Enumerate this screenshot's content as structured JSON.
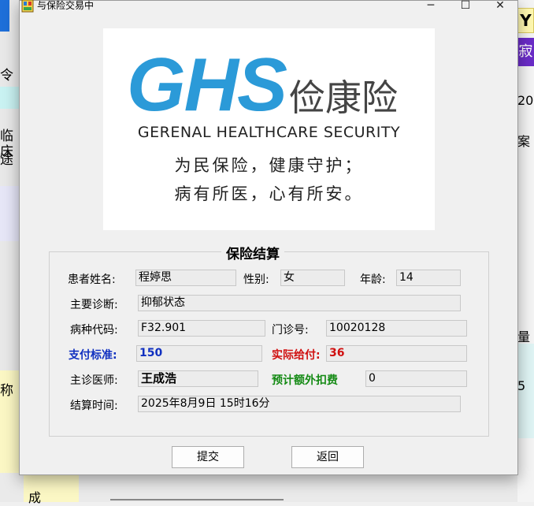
{
  "window": {
    "title": "与保险交易中",
    "min_icon": "minimize-icon",
    "max_icon": "maximize-icon",
    "close_icon": "close-icon"
  },
  "logo": {
    "brand": "GHS",
    "name_cn": "俭康险",
    "name_en": "GERENAL HEALTHCARE SECURITY",
    "slogan_line1": "为民保险，健康守护；",
    "slogan_line2": "病有所医，心有所安。",
    "brand_color": "#2b9ad8"
  },
  "settlement": {
    "group_title": "保险结算",
    "patient_name_label": "患者姓名:",
    "patient_name": "程婷思",
    "gender_label": "性别:",
    "gender": "女",
    "age_label": "年龄:",
    "age": "14",
    "diagnosis_label": "主要诊断:",
    "diagnosis": "抑郁状态",
    "disease_code_label": "病种代码:",
    "disease_code": "F32.901",
    "clinic_no_label": "门诊号:",
    "clinic_no": "10020128",
    "pay_standard_label": "支付标准:",
    "pay_standard": "150",
    "actual_pay_label": "实际给付:",
    "actual_pay": "36",
    "doctor_label": "主诊医师:",
    "doctor": "王成浩",
    "extra_deduction_label": "预计额外扣费",
    "extra_deduction": "0",
    "settle_time_label": "结算时间:",
    "settle_time": "2025年8月9日 15时16分"
  },
  "buttons": {
    "submit": "提交",
    "back": "返回"
  },
  "background": {
    "left_chars": [
      "令",
      "临床",
      "途"
    ],
    "right_chars": [
      "Y",
      "寂",
      "20",
      "案",
      "量",
      "5"
    ],
    "bottom_char": "成",
    "left_bottom_char": "称"
  }
}
